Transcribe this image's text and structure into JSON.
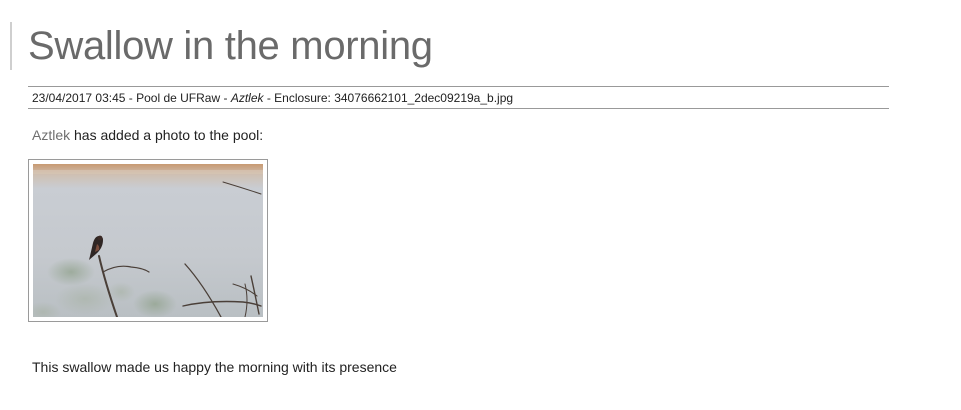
{
  "post": {
    "title": "Swallow in the morning",
    "meta": {
      "datetime": "23/04/2017 03:45",
      "sep1": " - ",
      "source": "Pool de UFRaw",
      "sep2": " - ",
      "author": "Aztlek",
      "sep3": " - ",
      "enclosure_label": "Enclosure: ",
      "enclosure_file": "34076662101_2dec09219a_b.jpg"
    },
    "intro": {
      "author": "Aztlek",
      "text": " has added a photo to the pool:"
    },
    "photo": {
      "subject": "swallow perched on a bare branch"
    },
    "caption": "This swallow made us happy the morning with its presence"
  },
  "colors": {
    "title": "#6a6a6a",
    "link": "#6f6f6f",
    "rule": "#999999",
    "text": "#222222"
  }
}
